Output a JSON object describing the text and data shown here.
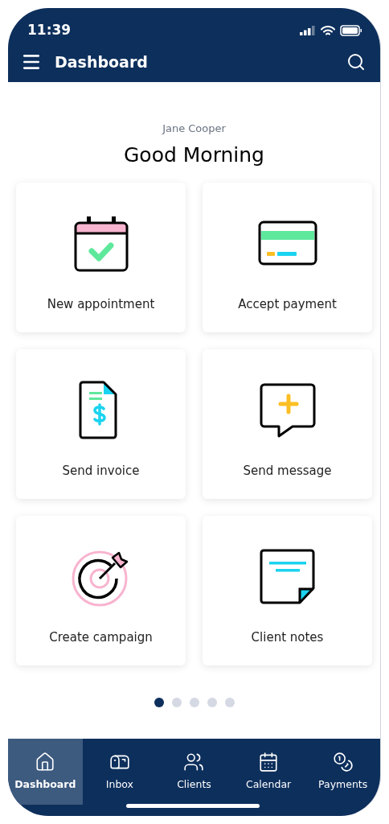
{
  "status_bar": {
    "time": "11:39"
  },
  "header": {
    "title": "Dashboard"
  },
  "greeting": {
    "user": "Jane Cooper",
    "text": "Good Morning"
  },
  "actions": [
    {
      "kind": "appointment",
      "label": "New appointment"
    },
    {
      "kind": "payment",
      "label": "Accept payment"
    },
    {
      "kind": "invoice",
      "label": "Send invoice"
    },
    {
      "kind": "message",
      "label": "Send message"
    },
    {
      "kind": "campaign",
      "label": "Create campaign"
    },
    {
      "kind": "notes",
      "label": "Client notes"
    }
  ],
  "pager": [
    {
      "selected": true
    },
    {
      "selected": false
    },
    {
      "selected": false
    },
    {
      "selected": false
    },
    {
      "selected": false
    }
  ],
  "tab_bar": [
    {
      "kind": "home",
      "label": "Dashboard",
      "selected": true
    },
    {
      "kind": "inbox",
      "label": "Inbox",
      "selected": false
    },
    {
      "kind": "clients",
      "label": "Clients",
      "selected": false
    },
    {
      "kind": "calendar",
      "label": "Calendar",
      "selected": false
    },
    {
      "kind": "payments",
      "label": "Payments",
      "selected": false
    }
  ]
}
